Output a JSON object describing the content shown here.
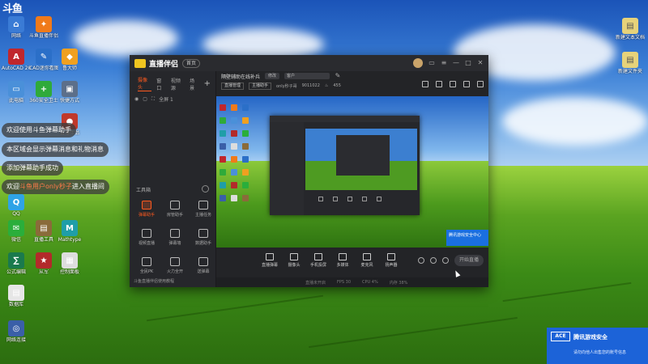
{
  "desktop": {
    "brand_mark": "斗鱼",
    "left_icons": [
      {
        "label": "网络",
        "color": "#3a7bd5",
        "glyph": "⌂"
      },
      {
        "label": "斗鱼直播伴侣",
        "color": "#f07a1a",
        "glyph": "✦"
      },
      {
        "label": "AutoCAD 2014",
        "color": "#c0272d",
        "glyph": "A"
      },
      {
        "label": "CAD迷你看图",
        "color": "#2b6fc8",
        "glyph": "✎"
      },
      {
        "label": "鲁大师",
        "color": "#f0a020",
        "glyph": "◆"
      },
      {
        "label": "此电脑",
        "color": "#4a90d9",
        "glyph": "▭"
      },
      {
        "label": "360安全卫士",
        "color": "#2faa3a",
        "glyph": "+"
      },
      {
        "label": "快捷方式",
        "color": "#5c6f8a",
        "glyph": "▣"
      },
      {
        "label": "直播伴侣",
        "color": "#c0392b",
        "glyph": "●"
      },
      {
        "label": "QQ",
        "color": "#2fa3e6",
        "glyph": "Q"
      },
      {
        "label": "微信",
        "color": "#2aae3b",
        "glyph": "✉"
      },
      {
        "label": "直播工具",
        "color": "#8a6b3a",
        "glyph": "▤"
      },
      {
        "label": "Mathtype",
        "color": "#1f9ea8",
        "glyph": "M"
      },
      {
        "label": "公式编辑",
        "color": "#1a7a4d",
        "glyph": "∑"
      },
      {
        "label": "从军",
        "color": "#b32a2a",
        "glyph": "★"
      },
      {
        "label": "控制面板",
        "color": "#dddddd",
        "glyph": "▦"
      },
      {
        "label": "数据库",
        "color": "#e6e6e6",
        "glyph": "▤"
      },
      {
        "label": "网络连接",
        "color": "#3a5fa8",
        "glyph": "◎"
      }
    ],
    "right_icons": [
      {
        "label": "新建文本文档",
        "color": "#e6d27a",
        "glyph": "▤"
      },
      {
        "label": "新建文件夹",
        "color": "#e6d27a",
        "glyph": "▤"
      }
    ]
  },
  "chat_overlay": {
    "messages": [
      {
        "text": "欢迎使用斗鱼弹幕助手",
        "highlight": ""
      },
      {
        "text": "本区域会显示弹幕消息和礼物消息",
        "highlight": ""
      },
      {
        "text": "添加弹幕助手成功",
        "highlight": ""
      },
      {
        "text": "欢迎",
        "highlight": "斗鱼用户only秒子",
        "suffix": "进入直播间"
      }
    ]
  },
  "app": {
    "title": "直播伴侣",
    "version_badge": "首页",
    "left_tabs": [
      "摄像头",
      "窗口",
      "视频源",
      "场景"
    ],
    "active_tab_index": 0,
    "scene_label": "全屏 1",
    "tools_heading": "工具箱",
    "tools": [
      {
        "label": "弹幕助手",
        "hot": true
      },
      {
        "label": "房管助手",
        "hot": false
      },
      {
        "label": "主播任务",
        "hot": false
      },
      {
        "label": "视频直播",
        "hot": false
      },
      {
        "label": "弹幕墙",
        "hot": false
      },
      {
        "label": "数据助手",
        "hot": false
      },
      {
        "label": "全民PK",
        "hot": false
      },
      {
        "label": "火力全开",
        "hot": false
      },
      {
        "label": "送弹幕",
        "hot": false
      }
    ],
    "bottom_notice": "斗鱼直播伴侣使用教程",
    "header": {
      "room_title": "隔壁辅助在线补兵",
      "modify_button": "修改",
      "category_chip": "英雄联盟",
      "category_field": "客户"
    },
    "subheader": {
      "chips": [
        "直播管理",
        "主播助手"
      ],
      "streamer": "only秒子哥",
      "room_id": "9011022",
      "hot": "455"
    },
    "bottom_controls": [
      "直播弹幕",
      "摄像头",
      "手机投屏",
      "多媒体",
      "麦克风",
      "扬声器"
    ],
    "start_live_button": "开始直播",
    "status": [
      "直播未开启",
      "FPS 30",
      "CPU 4%",
      "内存 38%"
    ],
    "preview_badge": "腾讯游戏安全中心"
  },
  "toast": {
    "logo": "ACE",
    "title": "腾讯游戏安全",
    "text": "请勿向他人出售您的账号信息"
  }
}
